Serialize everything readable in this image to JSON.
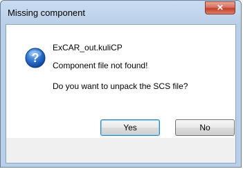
{
  "window": {
    "title": "Missing component",
    "close_glyph": "✕"
  },
  "message": {
    "icon": "question-icon",
    "line1": "ExCAR_out.kuliCP",
    "line2": "Component file not found!",
    "line3": "Do you want to unpack the SCS file?"
  },
  "buttons": {
    "yes": "Yes",
    "no": "No"
  }
}
